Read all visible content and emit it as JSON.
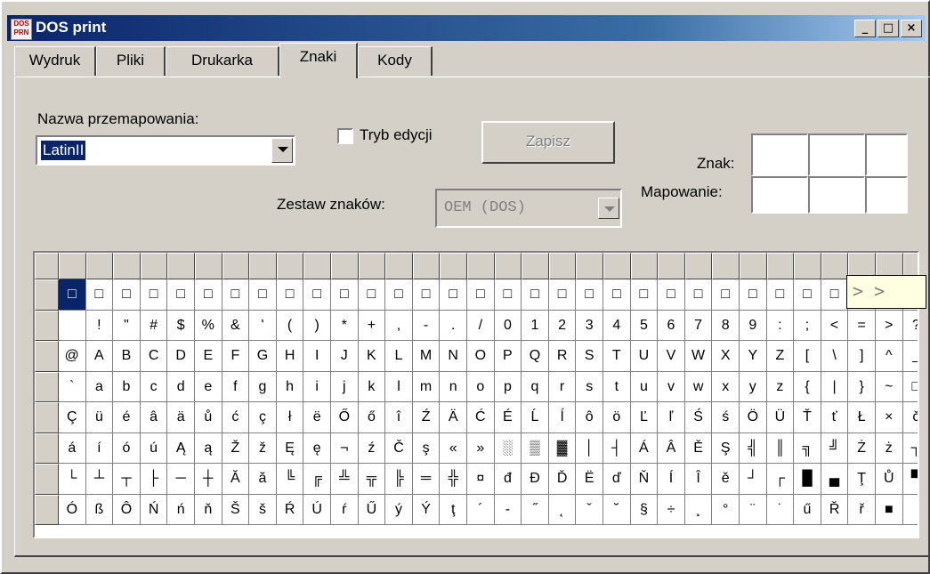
{
  "window": {
    "title": "DOS print"
  },
  "title_buttons": [
    "_",
    "□",
    "×"
  ],
  "tabs": [
    {
      "label": "Wydruk",
      "active": false
    },
    {
      "label": "Pliki",
      "active": false
    },
    {
      "label": "Drukarka",
      "active": false
    },
    {
      "label": "Znaki",
      "active": true
    },
    {
      "label": "Kody",
      "active": false
    }
  ],
  "remap": {
    "label": "Nazwa przemapowania:",
    "value": "LatinII"
  },
  "edit_mode": {
    "label": "Tryb edycji",
    "checked": false
  },
  "save_button": {
    "label": "Zapisz",
    "disabled": true
  },
  "charset": {
    "label": "Zestaw znaków:",
    "value": "OEM (DOS)",
    "disabled": true
  },
  "znak": {
    "label": "Znak:"
  },
  "mapowanie": {
    "label": "Mapowanie:"
  },
  "tooltip": {
    "text": "> >"
  },
  "char_rows": [
    [
      "□",
      "□",
      "□",
      "□",
      "□",
      "□",
      "□",
      "□",
      "□",
      "□",
      "□",
      "□",
      "□",
      "□",
      "□",
      "□",
      "□",
      "□",
      "□",
      "□",
      "□",
      "□",
      "□",
      "□",
      "□",
      "□",
      "□",
      "□",
      "□",
      "□",
      "□",
      "□"
    ],
    [
      " ",
      "!",
      "\"",
      "#",
      "$",
      "%",
      "&",
      "'",
      "(",
      ")",
      "*",
      "+",
      ",",
      "-",
      ".",
      "/",
      "0",
      "1",
      "2",
      "3",
      "4",
      "5",
      "6",
      "7",
      "8",
      "9",
      ":",
      ";",
      "<",
      "=",
      ">",
      "?"
    ],
    [
      "@",
      "A",
      "B",
      "C",
      "D",
      "E",
      "F",
      "G",
      "H",
      "I",
      "J",
      "K",
      "L",
      "M",
      "N",
      "O",
      "P",
      "Q",
      "R",
      "S",
      "T",
      "U",
      "V",
      "W",
      "X",
      "Y",
      "Z",
      "[",
      "\\",
      "]",
      "^",
      "_"
    ],
    [
      "`",
      "a",
      "b",
      "c",
      "d",
      "e",
      "f",
      "g",
      "h",
      "i",
      "j",
      "k",
      "l",
      "m",
      "n",
      "o",
      "p",
      "q",
      "r",
      "s",
      "t",
      "u",
      "v",
      "w",
      "x",
      "y",
      "z",
      "{",
      "|",
      "}",
      "~",
      "□"
    ],
    [
      "Ç",
      "ü",
      "é",
      "â",
      "ä",
      "ů",
      "ć",
      "ç",
      "ł",
      "ë",
      "Ő",
      "ő",
      "î",
      "Ź",
      "Ä",
      "Ć",
      "É",
      "Ĺ",
      "ĺ",
      "ô",
      "ö",
      "Ľ",
      "ľ",
      "Ś",
      "ś",
      "Ö",
      "Ü",
      "Ť",
      "ť",
      "Ł",
      "×",
      "č"
    ],
    [
      "á",
      "í",
      "ó",
      "ú",
      "Ą",
      "ą",
      "Ž",
      "ž",
      "Ę",
      "ę",
      "¬",
      "ź",
      "Č",
      "ş",
      "«",
      "»",
      "░",
      "▒",
      "▓",
      "│",
      "┤",
      "Á",
      "Â",
      "Ě",
      "Ş",
      "╣",
      "║",
      "╗",
      "╝",
      "Ż",
      "ż",
      "┐"
    ],
    [
      "└",
      "┴",
      "┬",
      "├",
      "─",
      "┼",
      "Ă",
      "ă",
      "╚",
      "╔",
      "╩",
      "╦",
      "╠",
      "═",
      "╬",
      "¤",
      "đ",
      "Đ",
      "Ď",
      "Ë",
      "ď",
      "Ň",
      "Í",
      "Î",
      "ě",
      "┘",
      "┌",
      "█",
      "▄",
      "Ţ",
      "Ů",
      "▀"
    ],
    [
      "Ó",
      "ß",
      "Ô",
      "Ń",
      "ń",
      "ň",
      "Š",
      "š",
      "Ŕ",
      "Ú",
      "ŕ",
      "Ű",
      "ý",
      "Ý",
      "ţ",
      "´",
      "-",
      "˝",
      "˛",
      "ˇ",
      "˘",
      "§",
      "÷",
      "¸",
      "°",
      "¨",
      "˙",
      "ű",
      "Ř",
      "ř",
      "■",
      " "
    ]
  ]
}
